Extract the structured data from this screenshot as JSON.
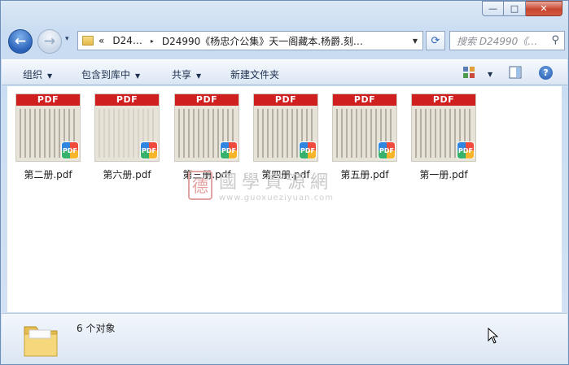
{
  "window": {
    "minimize_glyph": "—",
    "maximize_glyph": "□",
    "close_glyph": "✕"
  },
  "nav": {
    "back_glyph": "←",
    "forward_glyph": "→",
    "recent_glyph": "▾",
    "address_prefix": "«",
    "address_segments": [
      "D24…",
      "D24990《杨忠介公集》天一阁藏本.杨爵.刻…"
    ],
    "address_separator": "▸",
    "refresh_glyph": "⟳",
    "search_placeholder": "搜索 D24990《…",
    "search_icon": "magnifier-icon"
  },
  "toolbar": {
    "organize": "组织",
    "include_in_library": "包含到库中",
    "share": "共享",
    "new_folder": "新建文件夹",
    "dropdown_glyph": "▼",
    "help_glyph": "?"
  },
  "files": [
    {
      "name": "第二册.pdf",
      "label": "PDF",
      "badge": "PDF",
      "tone": "dark"
    },
    {
      "name": "第六册.pdf",
      "label": "PDF",
      "badge": "PDF",
      "tone": "light"
    },
    {
      "name": "第三册.pdf",
      "label": "PDF",
      "badge": "PDF",
      "tone": "dark"
    },
    {
      "name": "第四册.pdf",
      "label": "PDF",
      "badge": "PDF",
      "tone": "dark"
    },
    {
      "name": "第五册.pdf",
      "label": "PDF",
      "badge": "PDF",
      "tone": "dark"
    },
    {
      "name": "第一册.pdf",
      "label": "PDF",
      "badge": "PDF",
      "tone": "dark"
    }
  ],
  "watermark": {
    "seal": "德",
    "title": "國學資源網",
    "url": "www.guoxueziyuan.com"
  },
  "status": {
    "item_count": "6 个对象"
  },
  "colors": {
    "pdf_band": "#cf1f1f",
    "accent": "#2a62b9"
  }
}
